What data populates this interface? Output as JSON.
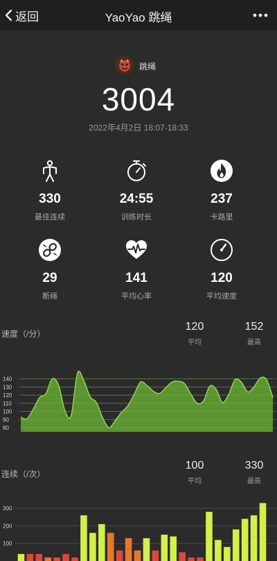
{
  "nav": {
    "back_label": "返回",
    "title": "YaoYao 跳绳"
  },
  "session": {
    "user_name": "跳绳",
    "total_jumps": "3004",
    "time_range": "2022年4月2日 18:07-18:33"
  },
  "stats": [
    {
      "icon": "jumping-person-icon",
      "value": "330",
      "label": "最佳连续"
    },
    {
      "icon": "stopwatch-icon",
      "value": "24:55",
      "label": "训练时长"
    },
    {
      "icon": "flame-icon",
      "value": "237",
      "label": "卡路里"
    },
    {
      "icon": "broken-link-icon",
      "value": "29",
      "label": "断绳"
    },
    {
      "icon": "heart-rate-icon",
      "value": "141",
      "label": "平均心率"
    },
    {
      "icon": "speedometer-icon",
      "value": "120",
      "label": "平均速度"
    }
  ],
  "speed_section": {
    "title": "速度（/分）",
    "avg_value": "120",
    "avg_label": "平均",
    "max_value": "152",
    "max_label": "最高"
  },
  "streak_section": {
    "title": "连续（/次）",
    "avg_value": "100",
    "avg_label": "平均",
    "max_value": "330",
    "max_label": "最高"
  },
  "colors": {
    "background": "#2b2b2b",
    "nav_background": "#1f1f1f",
    "area_green": "#5e9a32",
    "line_green": "#8fd14f",
    "bar_lime": "#d2f04a",
    "bar_orange": "#e8772e",
    "bar_red": "#d94a3a"
  },
  "chart_data": [
    {
      "type": "area",
      "ylim": [
        75,
        155
      ],
      "y_ticks": [
        "140",
        "130",
        "120",
        "110",
        "100",
        "90",
        "80"
      ],
      "x": [
        0,
        1,
        2,
        3,
        4,
        5,
        6,
        7,
        8,
        9,
        10,
        11,
        12,
        13,
        14,
        15,
        16,
        17,
        18,
        19,
        20,
        21,
        22,
        23,
        24,
        25,
        26,
        27,
        28,
        29,
        30,
        31,
        32,
        33,
        34,
        35,
        36,
        37,
        38,
        39,
        40
      ],
      "values": [
        93,
        91,
        103,
        117,
        122,
        140,
        132,
        101,
        95,
        147,
        138,
        118,
        111,
        92,
        80,
        89,
        99,
        107,
        121,
        136,
        132,
        125,
        122,
        129,
        136,
        137,
        134,
        121,
        110,
        113,
        131,
        127,
        111,
        121,
        139,
        136,
        124,
        130,
        141,
        139,
        117
      ]
    },
    {
      "type": "bar",
      "ylim": [
        0,
        340
      ],
      "y_ticks": [
        "300",
        "200",
        "100"
      ],
      "values": [
        40,
        40,
        40,
        20,
        20,
        40,
        20,
        260,
        160,
        210,
        160,
        60,
        130,
        60,
        130,
        60,
        150,
        140,
        50,
        20,
        20,
        280,
        120,
        80,
        180,
        240,
        260,
        330
      ],
      "categories": [
        "lime",
        "red",
        "red",
        "orange",
        "red",
        "red",
        "red",
        "lime",
        "lime",
        "lime",
        "orange",
        "red",
        "orange",
        "orange",
        "lime",
        "red",
        "lime",
        "lime",
        "red",
        "red",
        "red",
        "lime",
        "lime",
        "lime",
        "lime",
        "lime",
        "lime",
        "lime"
      ]
    }
  ]
}
